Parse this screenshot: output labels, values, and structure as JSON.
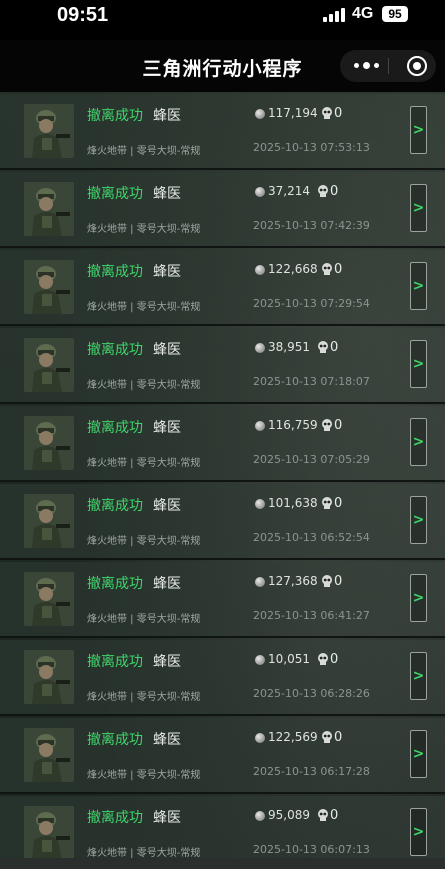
{
  "status_bar": {
    "time": "09:51",
    "network": "4G",
    "battery": "95"
  },
  "nav": {
    "title": "三角洲行动小程序"
  },
  "records": [
    {
      "result": "撤离成功",
      "operator": "蜂医",
      "map": "烽火地带 | 零号大坝-常规",
      "amount": "117,194",
      "kills": "0",
      "datetime": "2025-10-13 07:53:13",
      "action": ">"
    },
    {
      "result": "撤离成功",
      "operator": "蜂医",
      "map": "烽火地带 | 零号大坝-常规",
      "amount": "37,214",
      "kills": "0",
      "datetime": "2025-10-13 07:42:39",
      "action": ">"
    },
    {
      "result": "撤离成功",
      "operator": "蜂医",
      "map": "烽火地带 | 零号大坝-常规",
      "amount": "122,668",
      "kills": "0",
      "datetime": "2025-10-13 07:29:54",
      "action": ">"
    },
    {
      "result": "撤离成功",
      "operator": "蜂医",
      "map": "烽火地带 | 零号大坝-常规",
      "amount": "38,951",
      "kills": "0",
      "datetime": "2025-10-13 07:18:07",
      "action": ">"
    },
    {
      "result": "撤离成功",
      "operator": "蜂医",
      "map": "烽火地带 | 零号大坝-常规",
      "amount": "116,759",
      "kills": "0",
      "datetime": "2025-10-13 07:05:29",
      "action": ">"
    },
    {
      "result": "撤离成功",
      "operator": "蜂医",
      "map": "烽火地带 | 零号大坝-常规",
      "amount": "101,638",
      "kills": "0",
      "datetime": "2025-10-13 06:52:54",
      "action": ">"
    },
    {
      "result": "撤离成功",
      "operator": "蜂医",
      "map": "烽火地带 | 零号大坝-常规",
      "amount": "127,368",
      "kills": "0",
      "datetime": "2025-10-13 06:41:27",
      "action": ">"
    },
    {
      "result": "撤离成功",
      "operator": "蜂医",
      "map": "烽火地带 | 零号大坝-常规",
      "amount": "10,051",
      "kills": "0",
      "datetime": "2025-10-13 06:28:26",
      "action": ">"
    },
    {
      "result": "撤离成功",
      "operator": "蜂医",
      "map": "烽火地带 | 零号大坝-常规",
      "amount": "122,569",
      "kills": "0",
      "datetime": "2025-10-13 06:17:28",
      "action": ">"
    },
    {
      "result": "撤离成功",
      "operator": "蜂医",
      "map": "烽火地带 | 零号大坝-常规",
      "amount": "95,089",
      "kills": "0",
      "datetime": "2025-10-13 06:07:13",
      "action": ">"
    }
  ],
  "icons": {
    "coin": "coin-icon",
    "skull": "skull-icon",
    "avatar": "operator-avatar"
  },
  "colors": {
    "success": "#3fd46a",
    "background": "#1e2822",
    "nav": "#050505"
  }
}
